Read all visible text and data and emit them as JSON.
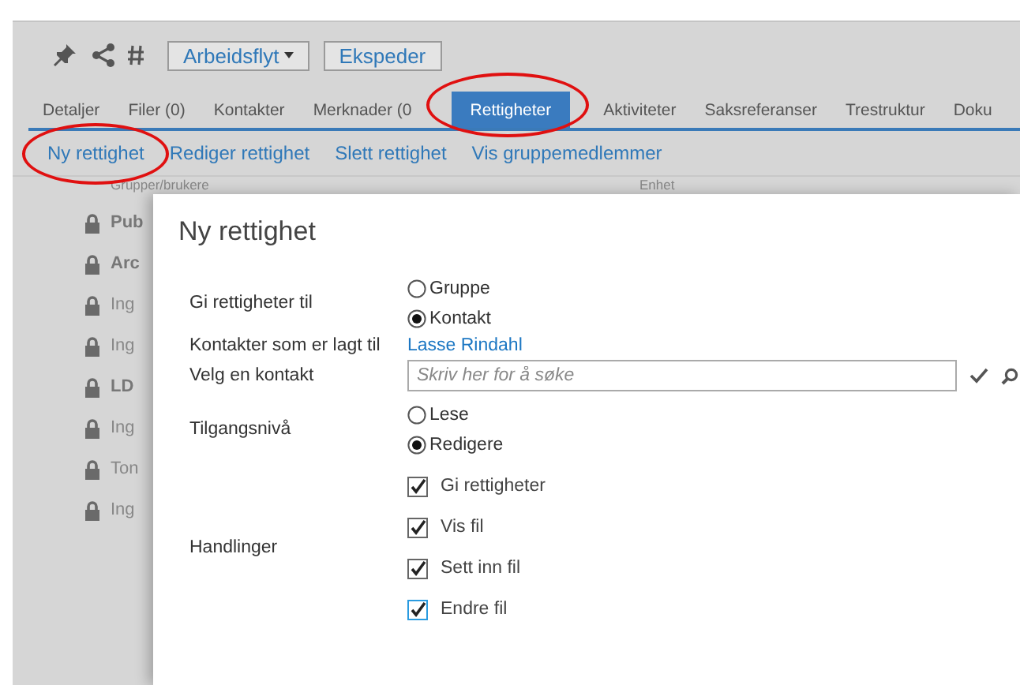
{
  "toolbar": {
    "buttons": [
      {
        "label": "Arbeidsflyt",
        "dropdown": true
      },
      {
        "label": "Ekspeder",
        "dropdown": false
      }
    ]
  },
  "tabs": [
    {
      "label": "Detaljer",
      "selected": false,
      "circled": false
    },
    {
      "label": "Filer (0)",
      "selected": false,
      "circled": false
    },
    {
      "label": "Kontakter",
      "selected": false,
      "circled": false
    },
    {
      "label": "Merknader (0",
      "selected": false,
      "circled": false
    },
    {
      "label": "Rettigheter",
      "selected": true,
      "circled": true
    },
    {
      "label": "Aktiviteter",
      "selected": false,
      "circled": false
    },
    {
      "label": "Saksreferanser",
      "selected": false,
      "circled": false
    },
    {
      "label": "Trestruktur",
      "selected": false,
      "circled": false
    },
    {
      "label": "Doku",
      "selected": false,
      "circled": false
    }
  ],
  "actions": [
    {
      "label": "Ny rettighet",
      "circled": true
    },
    {
      "label": "Rediger rettighet",
      "circled": false
    },
    {
      "label": "Slett rettighet",
      "circled": false
    },
    {
      "label": "Vis gruppemedlemmer",
      "circled": false
    }
  ],
  "list": {
    "columns": [
      "Grupper/brukere",
      "Enhet"
    ],
    "rows": [
      {
        "name": "Pub",
        "bold": true
      },
      {
        "name": "Arc",
        "bold": true
      },
      {
        "name": "Ing",
        "bold": false
      },
      {
        "name": "Ing",
        "bold": false
      },
      {
        "name": "LD",
        "bold": true
      },
      {
        "name": "Ing",
        "bold": false
      },
      {
        "name": "Ton",
        "bold": false
      },
      {
        "name": "Ing",
        "bold": false
      }
    ]
  },
  "dialog": {
    "title": "Ny rettighet",
    "fields": [
      {
        "kind": "radio",
        "label": "Gi rettigheter til",
        "options": [
          {
            "label": "Gruppe",
            "selected": false
          },
          {
            "label": "Kontakt",
            "selected": true
          }
        ]
      },
      {
        "kind": "link",
        "label": "Kontakter som er lagt til",
        "value": "Lasse Rindahl"
      },
      {
        "kind": "search",
        "label": "Velg en kontakt",
        "placeholder": "Skriv her for å søke"
      },
      {
        "kind": "radio",
        "label": "Tilgangsnivå",
        "options": [
          {
            "label": "Lese",
            "selected": false
          },
          {
            "label": "Redigere",
            "selected": true
          }
        ]
      },
      {
        "kind": "checks",
        "label": "Handlinger",
        "options": [
          {
            "label": "Gi rettigheter",
            "checked": true,
            "color": "#666666"
          },
          {
            "label": "Vis fil",
            "checked": true,
            "color": "#666666"
          },
          {
            "label": "Sett inn fil",
            "checked": true,
            "color": "#666666"
          },
          {
            "label": "Endre fil",
            "checked": true,
            "color": "#2a9be0"
          }
        ]
      }
    ]
  }
}
